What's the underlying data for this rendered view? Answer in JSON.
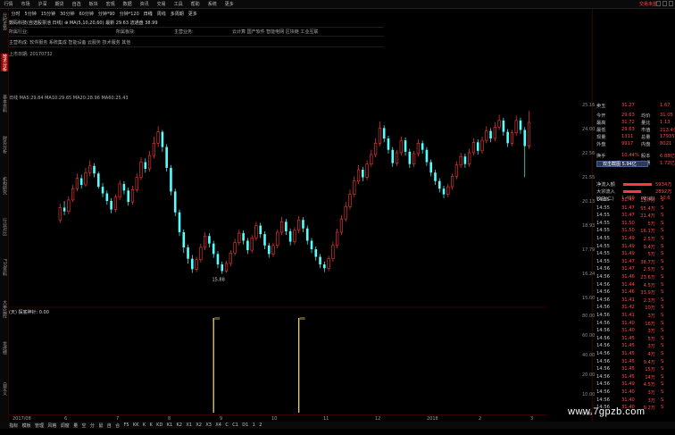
{
  "menu": {
    "items": [
      "行情",
      "市场",
      "沪深",
      "期货",
      "自选",
      "板块",
      "宏观",
      "数据",
      "资讯",
      "交易",
      "工具",
      "帮助",
      "系统",
      "更多"
    ],
    "brand": "交易未登"
  },
  "periods": [
    "分时",
    "5分钟",
    "15分钟",
    "30分钟",
    "60分钟",
    "分钟*90",
    "分钟*120",
    "日线",
    "周线",
    "多周期",
    "更多"
  ],
  "sidebar": [
    {
      "label": "分时走势",
      "red": false
    },
    {
      "label": "技术分析",
      "red": true
    },
    {
      "label": "基本资料",
      "red": false
    },
    {
      "label": "财务分析",
      "red": false
    },
    {
      "label": "机构研究",
      "red": false
    },
    {
      "label": "行业对比",
      "red": false
    },
    {
      "label": "F10资料",
      "red": false
    },
    {
      "label": "大单监控",
      "red": false
    },
    {
      "label": "龙虎榜",
      "red": false
    },
    {
      "label": "自定义",
      "red": false
    }
  ],
  "info": {
    "line1": "数码科技(自选股票池 日线)  ⊕ MA(5,10,20,60)  最新 29.63  流通盘 38.99",
    "line2a": "所属行业:",
    "line2b": "所属板块:",
    "line2c": "主营业务:",
    "line2d": "云计算 国产软件 智能电网 区块链 工业互联",
    "line3": "主营构成: 软件服务 系统集成 智能设备 云服务 技术服务 其他",
    "line4": "上市日期:     20170732"
  },
  "chart": {
    "header": "日线 MA5:29.84 MA10:29.65 MA20:28.96 MA60:25.43",
    "low_label": "15.88",
    "sub_header": "(天)  探底神针: 0.00",
    "price_axis": [
      "25.16",
      "24.00",
      "22.56",
      "21.55",
      "20.13",
      "18.93",
      "17.79",
      "16.24",
      "15.00"
    ],
    "sub_axis": [
      "80.00",
      "60.00",
      "40.00",
      "20.00",
      "10.00",
      "0.00"
    ],
    "x_axis": [
      "2017/08",
      "6",
      "7",
      "8",
      "9",
      "10",
      "11",
      "12",
      "2018",
      "2",
      "3"
    ]
  },
  "chart_data": {
    "type": "candlestick",
    "y_range": [
      13.5,
      33.5
    ],
    "candles": [
      [
        21.5,
        22.8,
        23.2,
        21.2
      ],
      [
        22.8,
        22.4,
        23.5,
        22.0
      ],
      [
        22.4,
        23.6,
        24.0,
        22.1
      ],
      [
        23.6,
        24.8,
        25.2,
        23.4
      ],
      [
        24.8,
        25.9,
        26.4,
        24.5
      ],
      [
        25.9,
        25.2,
        26.3,
        24.8
      ],
      [
        25.2,
        26.5,
        27.0,
        25.0
      ],
      [
        26.5,
        27.2,
        27.8,
        26.1
      ],
      [
        27.2,
        26.4,
        27.5,
        26.0
      ],
      [
        26.4,
        25.0,
        26.6,
        24.8
      ],
      [
        25.0,
        24.3,
        25.4,
        23.9
      ],
      [
        24.3,
        23.5,
        24.6,
        23.1
      ],
      [
        23.5,
        22.6,
        23.8,
        22.2
      ],
      [
        22.6,
        23.9,
        24.2,
        22.3
      ],
      [
        23.9,
        25.3,
        25.7,
        23.6
      ],
      [
        25.3,
        24.6,
        25.6,
        24.2
      ],
      [
        24.6,
        23.4,
        24.9,
        23.0
      ],
      [
        23.4,
        24.7,
        25.1,
        23.1
      ],
      [
        24.7,
        26.0,
        26.4,
        24.4
      ],
      [
        26.0,
        27.6,
        28.1,
        25.7
      ],
      [
        27.6,
        26.9,
        28.0,
        26.5
      ],
      [
        26.9,
        28.3,
        28.8,
        26.6
      ],
      [
        28.3,
        29.6,
        30.3,
        28.0
      ],
      [
        29.6,
        30.8,
        31.4,
        29.2
      ],
      [
        30.8,
        29.2,
        31.0,
        28.7
      ],
      [
        29.2,
        27.0,
        29.5,
        26.6
      ],
      [
        27.0,
        24.5,
        27.3,
        24.1
      ],
      [
        24.5,
        22.3,
        24.8,
        21.9
      ],
      [
        22.3,
        20.2,
        22.6,
        19.8
      ],
      [
        20.2,
        18.6,
        20.5,
        18.0
      ],
      [
        18.6,
        17.4,
        18.9,
        16.9
      ],
      [
        17.4,
        16.3,
        17.8,
        15.9
      ],
      [
        16.3,
        17.3,
        17.6,
        16.0
      ],
      [
        17.3,
        18.6,
        19.0,
        17.0
      ],
      [
        18.6,
        19.8,
        20.2,
        18.3
      ],
      [
        19.8,
        19.0,
        20.1,
        18.6
      ],
      [
        19.0,
        17.9,
        19.3,
        17.5
      ],
      [
        17.9,
        16.8,
        18.2,
        16.4
      ],
      [
        16.8,
        16.1,
        17.1,
        15.8
      ],
      [
        16.1,
        16.9,
        17.2,
        15.9
      ],
      [
        16.9,
        18.0,
        18.3,
        16.6
      ],
      [
        18.0,
        19.1,
        19.5,
        17.7
      ],
      [
        19.1,
        20.1,
        20.5,
        18.8
      ],
      [
        20.1,
        19.3,
        20.4,
        18.9
      ],
      [
        19.3,
        18.3,
        19.6,
        17.9
      ],
      [
        18.3,
        19.6,
        19.9,
        18.0
      ],
      [
        19.6,
        20.9,
        21.3,
        19.3
      ],
      [
        20.9,
        20.0,
        21.2,
        19.6
      ],
      [
        20.0,
        18.8,
        20.3,
        18.4
      ],
      [
        18.8,
        17.9,
        19.1,
        17.5
      ],
      [
        17.9,
        18.8,
        19.1,
        17.6
      ],
      [
        18.8,
        20.2,
        20.5,
        18.5
      ],
      [
        20.2,
        21.3,
        21.8,
        19.9
      ],
      [
        21.3,
        20.3,
        21.6,
        19.9
      ],
      [
        20.3,
        19.2,
        20.6,
        18.8
      ],
      [
        19.2,
        20.4,
        20.7,
        18.9
      ],
      [
        20.4,
        21.5,
        21.9,
        20.1
      ],
      [
        21.5,
        20.6,
        21.8,
        20.2
      ],
      [
        20.6,
        19.3,
        20.9,
        18.9
      ],
      [
        19.3,
        18.4,
        19.6,
        18.0
      ],
      [
        18.4,
        17.6,
        18.7,
        17.2
      ],
      [
        17.6,
        16.8,
        17.9,
        16.4
      ],
      [
        16.8,
        16.4,
        17.1,
        16.0
      ],
      [
        16.4,
        17.4,
        17.7,
        16.1
      ],
      [
        17.4,
        18.8,
        19.2,
        17.1
      ],
      [
        18.8,
        20.2,
        20.6,
        18.5
      ],
      [
        20.2,
        21.6,
        22.0,
        19.9
      ],
      [
        21.6,
        22.9,
        23.4,
        21.3
      ],
      [
        22.9,
        24.2,
        24.7,
        22.6
      ],
      [
        24.2,
        25.6,
        26.1,
        23.9
      ],
      [
        25.6,
        26.8,
        27.3,
        25.3
      ],
      [
        26.8,
        26.0,
        27.1,
        25.6
      ],
      [
        26.0,
        27.4,
        27.8,
        25.7
      ],
      [
        27.4,
        28.4,
        28.9,
        27.1
      ],
      [
        28.4,
        29.6,
        30.1,
        28.1
      ],
      [
        29.6,
        31.2,
        31.9,
        29.3
      ],
      [
        31.2,
        30.1,
        31.5,
        29.7
      ],
      [
        30.1,
        28.9,
        30.4,
        28.5
      ],
      [
        28.9,
        27.5,
        29.2,
        27.1
      ],
      [
        27.5,
        28.6,
        28.9,
        27.2
      ],
      [
        28.6,
        29.9,
        30.3,
        28.3
      ],
      [
        29.9,
        28.7,
        30.2,
        28.3
      ],
      [
        28.7,
        27.4,
        29.0,
        27.0
      ],
      [
        27.4,
        28.5,
        28.8,
        27.1
      ],
      [
        28.5,
        29.6,
        30.0,
        28.2
      ],
      [
        29.6,
        28.9,
        29.9,
        28.5
      ],
      [
        28.9,
        27.6,
        29.2,
        27.2
      ],
      [
        27.6,
        26.5,
        27.9,
        26.1
      ],
      [
        26.5,
        25.6,
        26.8,
        25.2
      ],
      [
        25.6,
        24.8,
        25.9,
        24.4
      ],
      [
        24.8,
        24.2,
        25.1,
        23.8
      ],
      [
        24.2,
        25.0,
        25.3,
        23.9
      ],
      [
        25.0,
        26.1,
        26.4,
        24.7
      ],
      [
        26.1,
        27.3,
        27.7,
        25.8
      ],
      [
        27.3,
        28.2,
        28.6,
        27.0
      ],
      [
        28.2,
        27.4,
        28.5,
        27.0
      ],
      [
        27.4,
        28.6,
        29.0,
        27.1
      ],
      [
        28.6,
        29.7,
        30.1,
        28.3
      ],
      [
        29.7,
        28.8,
        30.0,
        28.4
      ],
      [
        28.8,
        29.9,
        30.3,
        28.5
      ],
      [
        29.9,
        30.9,
        31.4,
        29.6
      ],
      [
        30.9,
        30.1,
        31.2,
        29.7
      ],
      [
        30.1,
        31.3,
        31.8,
        29.8
      ],
      [
        31.3,
        32.0,
        32.6,
        31.0
      ],
      [
        32.0,
        30.8,
        32.3,
        30.4
      ],
      [
        30.8,
        29.6,
        31.1,
        29.2
      ],
      [
        29.6,
        30.7,
        31.0,
        29.3
      ],
      [
        30.7,
        32.0,
        32.5,
        30.4
      ],
      [
        32.0,
        31.0,
        32.3,
        30.6
      ],
      [
        31.0,
        29.3,
        31.3,
        26.0
      ],
      [
        29.3,
        31.8,
        33.0,
        29.0
      ]
    ],
    "indicator": "探底神针",
    "spikes": [
      {
        "index": 36,
        "value": 100
      },
      {
        "index": 56,
        "value": 100
      }
    ]
  },
  "quote": {
    "rows": [
      {
        "k": "卖五",
        "v": "31.27",
        "k2": "",
        "v2": "1.67"
      },
      {
        "k": "今开",
        "v": "29.63",
        "k2": "均价",
        "v2": "31.05"
      },
      {
        "k": "最高",
        "v": "31.72",
        "k2": "量比",
        "v2": "1.13"
      },
      {
        "k": "最低",
        "v": "29.63",
        "k2": "市值",
        "v2": "213.4亿"
      },
      {
        "k": "现量",
        "v": "1311",
        "k2": "总量",
        "v2": "17935"
      },
      {
        "k": "外盘",
        "v": "9917",
        "k2": "内盘",
        "v2": "8021"
      },
      {
        "k": "换手",
        "v": "10.44%",
        "k2": "股本",
        "v2": "6.88亿"
      },
      {
        "k": "",
        "v": "",
        "k2": "流通",
        "v2": "1.72亿"
      },
      {
        "k": "收益(二)",
        "v": "1.460",
        "k2": "PE(动)",
        "v2": "10.6"
      }
    ],
    "tooltip": "双击截图  5.94亿",
    "flow_in_label": "净流入额",
    "flow_in_value": "5934万",
    "big_in_label": "大宗流入",
    "big_in_value": "2892万"
  },
  "ticks": [
    {
      "t": "14:55",
      "p": "31.47",
      "v": "15.7万",
      "bs": "S"
    },
    {
      "t": "14:55",
      "p": "31.47",
      "v": "55.4万",
      "bs": "S"
    },
    {
      "t": "14:55",
      "p": "31.47",
      "v": "21.4万",
      "bs": "S"
    },
    {
      "t": "14:55",
      "p": "31.50",
      "v": "5万",
      "bs": "S"
    },
    {
      "t": "14:55",
      "p": "31.50",
      "v": "16.1万",
      "bs": "S"
    },
    {
      "t": "14:55",
      "p": "31.49",
      "v": "2.5万",
      "bs": "S"
    },
    {
      "t": "14:55",
      "p": "31.49",
      "v": "9.4万",
      "bs": "S"
    },
    {
      "t": "14:55",
      "p": "31.49",
      "v": "5万",
      "bs": "S"
    },
    {
      "t": "14:55",
      "p": "31.47",
      "v": "38.7万",
      "bs": "S"
    },
    {
      "t": "14:56",
      "p": "31.47",
      "v": "2.5万",
      "bs": "S"
    },
    {
      "t": "14:56",
      "p": "31.46",
      "v": "23.6万",
      "bs": "S"
    },
    {
      "t": "14:56",
      "p": "31.44",
      "v": "4.5万",
      "bs": "S"
    },
    {
      "t": "14:56",
      "p": "31.46",
      "v": "33.9万",
      "bs": "S"
    },
    {
      "t": "14:56",
      "p": "31.41",
      "v": "2.3万",
      "bs": "S"
    },
    {
      "t": "14:56",
      "p": "31.42",
      "v": "10万",
      "bs": "S"
    },
    {
      "t": "14:56",
      "p": "31.41",
      "v": "3万",
      "bs": "S"
    },
    {
      "t": "14:56",
      "p": "31.40",
      "v": "16万",
      "bs": "S"
    },
    {
      "t": "14:56",
      "p": "31.40",
      "v": "3万",
      "bs": "S"
    },
    {
      "t": "14:56",
      "p": "31.45",
      "v": "5万",
      "bs": "S"
    },
    {
      "t": "14:56",
      "p": "31.45",
      "v": "3万",
      "bs": "S"
    },
    {
      "t": "14:56",
      "p": "31.45",
      "v": "4万",
      "bs": "S"
    },
    {
      "t": "14:56",
      "p": "31.45",
      "v": "9.4万",
      "bs": "S"
    },
    {
      "t": "14:56",
      "p": "31.45",
      "v": "15万",
      "bs": "S"
    },
    {
      "t": "14:56",
      "p": "31.45",
      "v": "14万",
      "bs": "S"
    },
    {
      "t": "14:56",
      "p": "31.49",
      "v": "4.5万",
      "bs": "S"
    },
    {
      "t": "14:56",
      "p": "31.40",
      "v": "3万",
      "bs": "S"
    },
    {
      "t": "14:56",
      "p": "31.40",
      "v": "3万",
      "bs": "S"
    },
    {
      "t": "14:56",
      "p": "31.40",
      "v": "9.2万",
      "bs": "S"
    }
  ],
  "bottom": [
    "指标",
    "模板",
    "管理",
    "风格",
    "调窗",
    "量",
    "空",
    "分",
    "鼠",
    "自",
    "合",
    "F5",
    "KK",
    "K",
    "K",
    "KD",
    "K1",
    "K2",
    "X1",
    "X2",
    "X3",
    "X4",
    "C",
    "C1",
    "D1",
    "1",
    "2"
  ],
  "watermark": "www.7gpzb.com",
  "colors": {
    "up": "#ff3838",
    "down": "#54ffff",
    "spike": "#ffe08a",
    "bg": "#000000"
  }
}
